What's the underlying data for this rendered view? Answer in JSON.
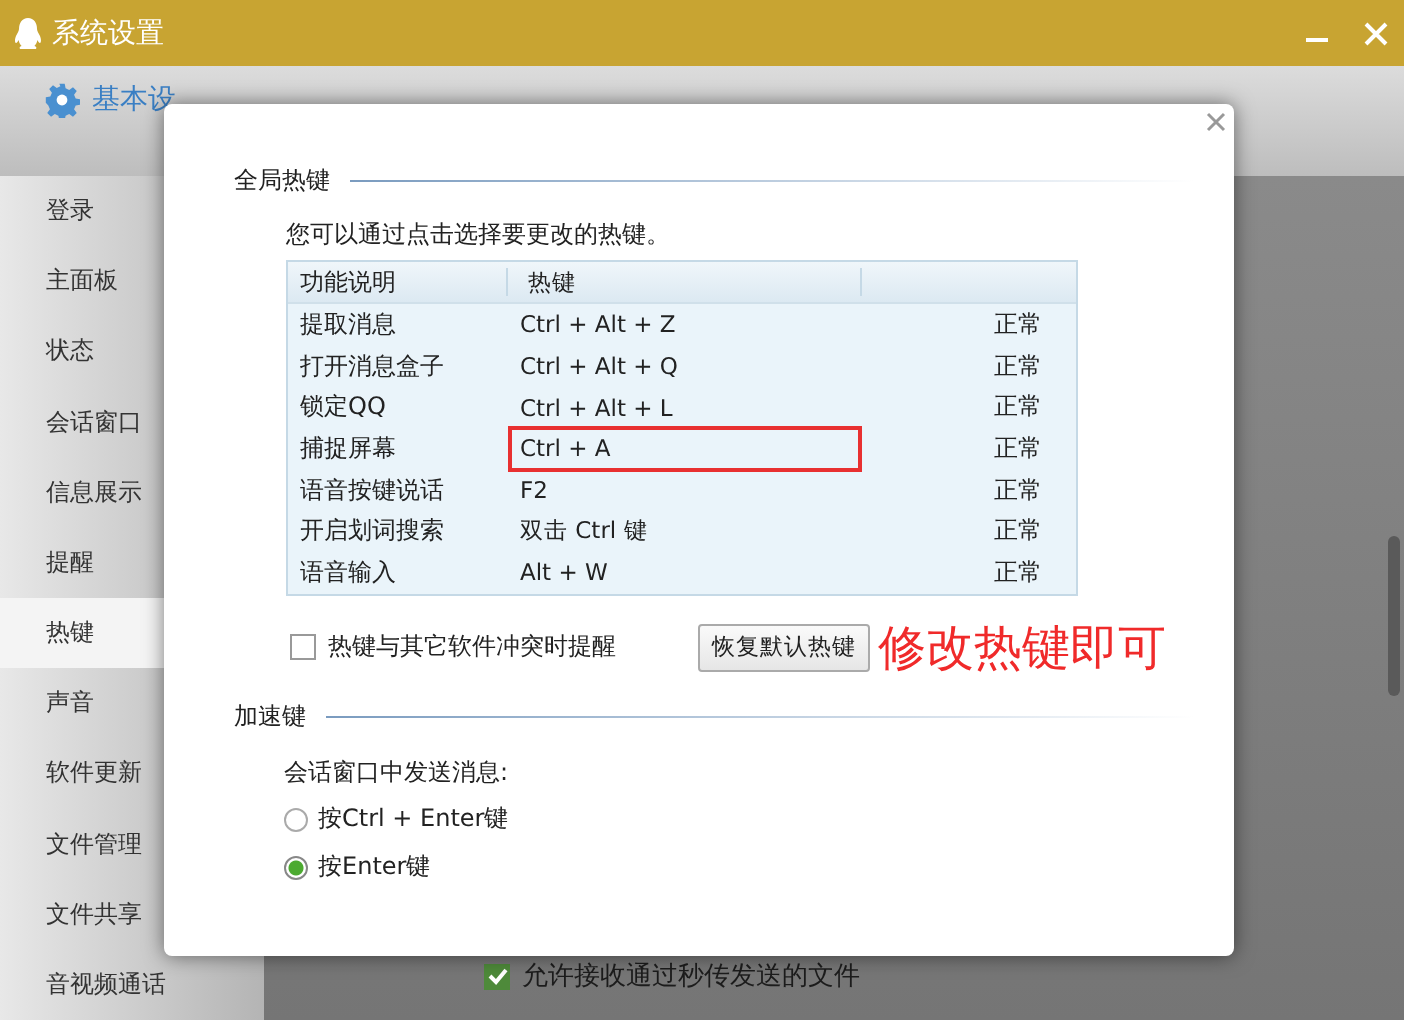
{
  "window": {
    "title": "系统设置"
  },
  "tabs": [
    {
      "label": "基本设",
      "selected": true
    }
  ],
  "sidebar": {
    "items": [
      {
        "label": "登录",
        "selected": false
      },
      {
        "label": "主面板",
        "selected": false
      },
      {
        "label": "状态",
        "selected": false
      },
      {
        "label": "会话窗口",
        "selected": false
      },
      {
        "label": "信息展示",
        "selected": false
      },
      {
        "label": "提醒",
        "selected": false
      },
      {
        "label": "热键",
        "selected": true
      },
      {
        "label": "声音",
        "selected": false
      },
      {
        "label": "软件更新",
        "selected": false
      },
      {
        "label": "文件管理",
        "selected": false
      },
      {
        "label": "文件共享",
        "selected": false
      },
      {
        "label": "音视频通话",
        "selected": false
      }
    ]
  },
  "background_option": {
    "label": "允许接收通过秒传发送的文件",
    "checked": true
  },
  "dialog": {
    "global_hotkeys": {
      "heading": "全局热键",
      "hint": "您可以通过点击选择要更改的热键。",
      "table": {
        "columns": [
          "功能说明",
          "热键"
        ],
        "rows": [
          {
            "function": "提取消息",
            "hotkey": "Ctrl + Alt + Z",
            "status": "正常",
            "highlighted": false
          },
          {
            "function": "打开消息盒子",
            "hotkey": "Ctrl + Alt + Q",
            "status": "正常",
            "highlighted": false
          },
          {
            "function": "锁定QQ",
            "hotkey": "Ctrl + Alt + L",
            "status": "正常",
            "highlighted": false
          },
          {
            "function": "捕捉屏幕",
            "hotkey": "Ctrl + A",
            "status": "正常",
            "highlighted": true
          },
          {
            "function": "语音按键说话",
            "hotkey": "F2",
            "status": "正常",
            "highlighted": false
          },
          {
            "function": "开启划词搜索",
            "hotkey": "双击 Ctrl 键",
            "status": "正常",
            "highlighted": false
          },
          {
            "function": "语音输入",
            "hotkey": "Alt + W",
            "status": "正常",
            "highlighted": false
          }
        ]
      },
      "conflict_checkbox": {
        "label": "热键与其它软件冲突时提醒",
        "checked": false
      },
      "restore_button": "恢复默认热键",
      "annotation": "修改热键即可"
    },
    "accelerator": {
      "heading": "加速键",
      "prompt": "会话窗口中发送消息:",
      "options": [
        {
          "label": "按Ctrl + Enter键",
          "selected": false
        },
        {
          "label": "按Enter键",
          "selected": true
        }
      ]
    }
  }
}
